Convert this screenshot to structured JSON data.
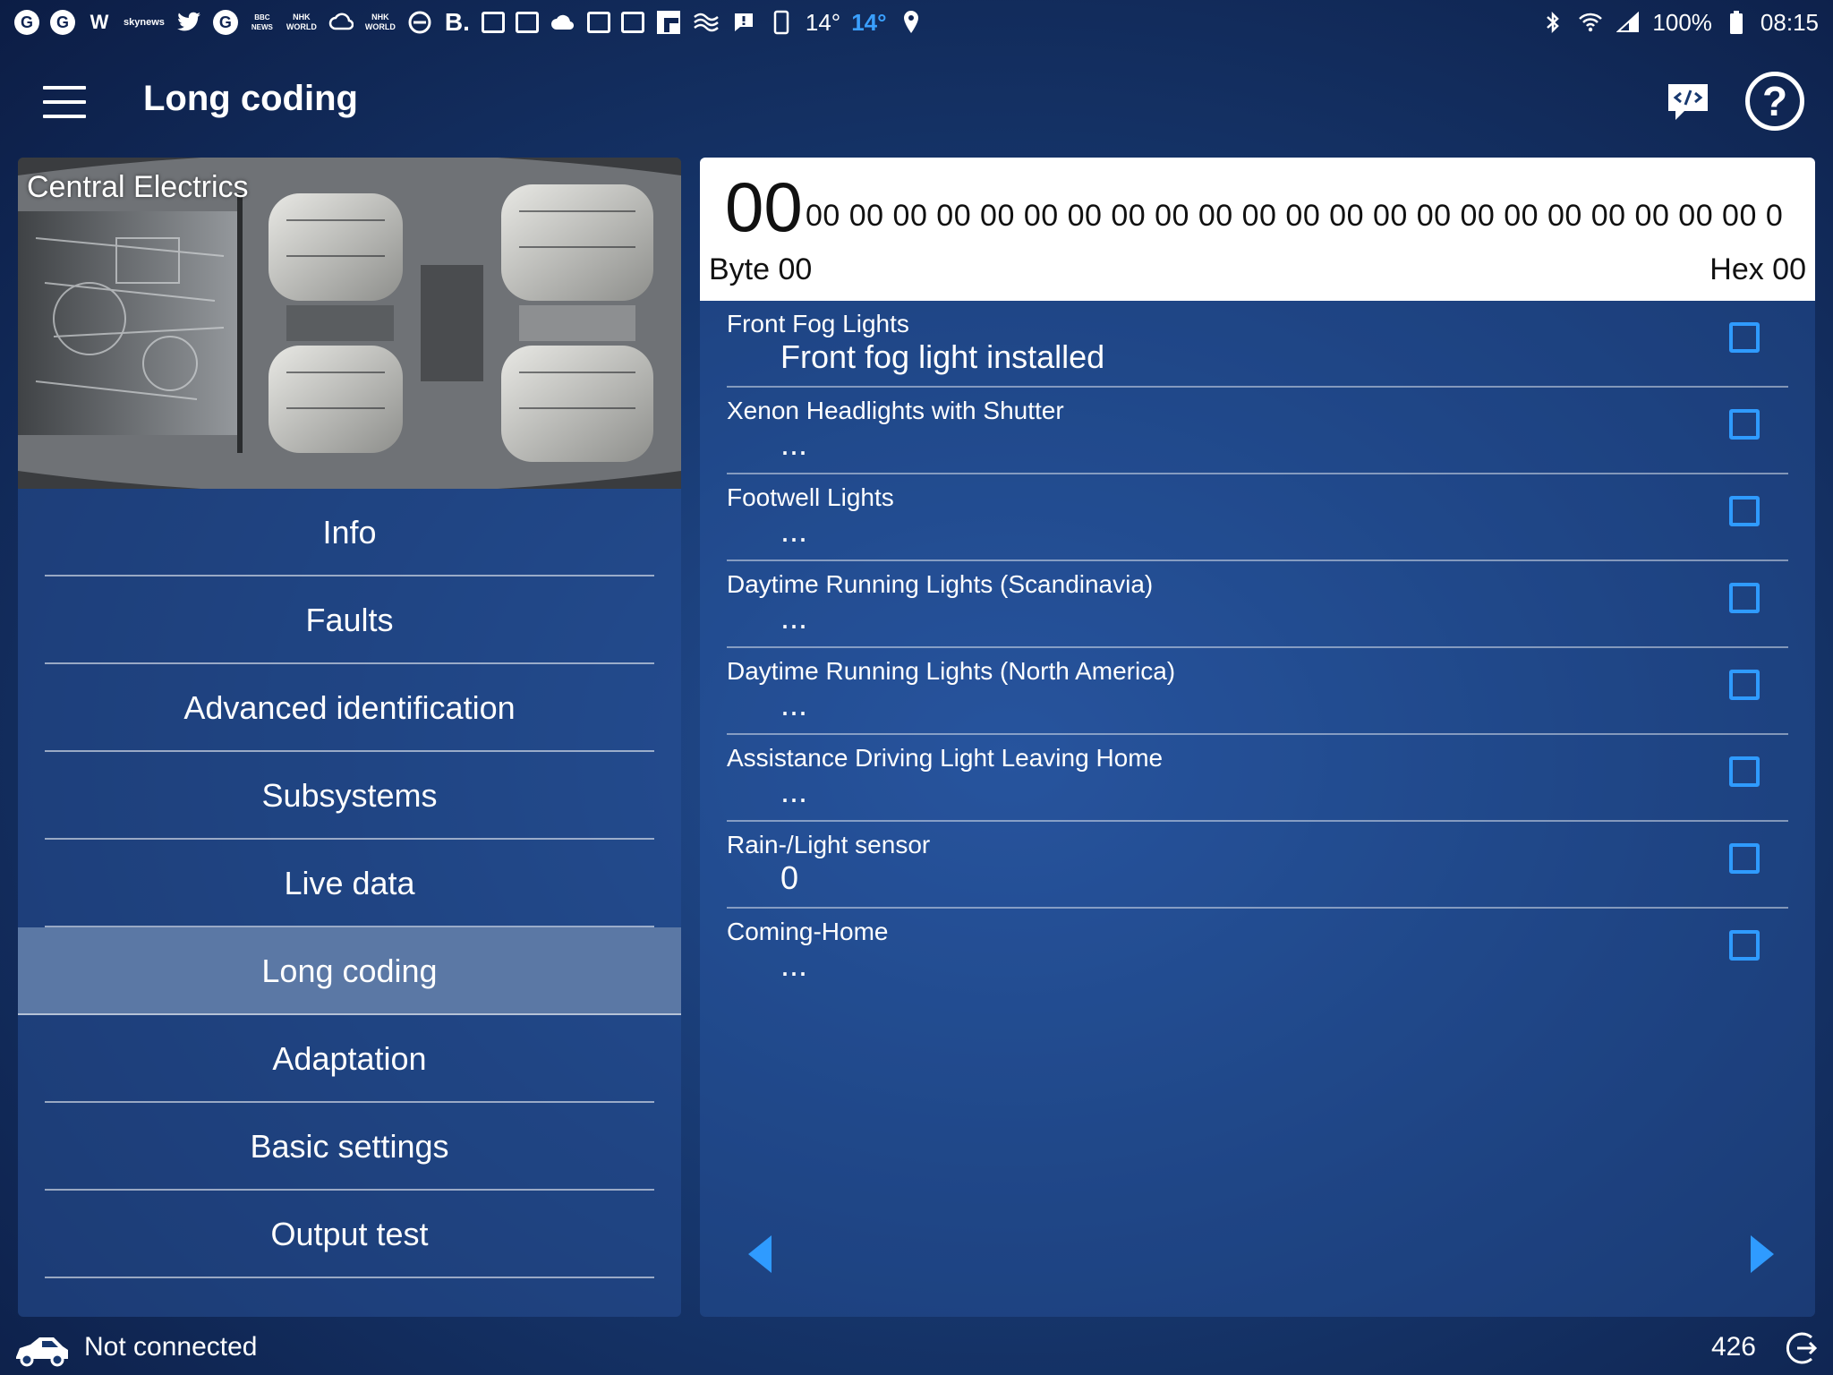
{
  "status_bar": {
    "left_icons": [
      "news-app-icon",
      "news-app-icon",
      "wikipedia-icon",
      "sky-news-icon",
      "twitter-icon",
      "news-app-icon",
      "bbc-news-icon",
      "nhk-world-icon",
      "cloud-sync-icon",
      "nhk-world-icon",
      "do-not-disturb-icon",
      "booking-icon",
      "calendar-icon",
      "gallery-icon",
      "cloud-icon",
      "calendar-icon",
      "calendar-icon",
      "flipboard-icon",
      "waves-icon",
      "alert-icon",
      "phone-icon",
      "location-icon"
    ],
    "sky_label": "sky",
    "news_label": "news",
    "bbc_label": "BBC NEWS",
    "nhk_label": "NHK WORLD",
    "wiki_label": "W",
    "booking_label": "B.",
    "temp_1": "14°",
    "temp_2": "14°",
    "battery": "100%",
    "time": "08:15",
    "accent_color": "#3aa0ff"
  },
  "app_bar": {
    "title": "Long coding",
    "menu_icon": "hamburger-menu-icon",
    "code_icon": "code-view-icon",
    "help_icon": "help-icon",
    "help_glyph": "?"
  },
  "left_panel": {
    "module_title": "Central Electrics",
    "nav_items": [
      {
        "label": "Info",
        "active": false
      },
      {
        "label": "Faults",
        "active": false
      },
      {
        "label": "Advanced identification",
        "active": false
      },
      {
        "label": "Subsystems",
        "active": false
      },
      {
        "label": "Live data",
        "active": false
      },
      {
        "label": "Long coding",
        "active": true
      },
      {
        "label": "Adaptation",
        "active": false
      },
      {
        "label": "Basic settings",
        "active": false
      },
      {
        "label": "Output test",
        "active": false
      }
    ]
  },
  "coding": {
    "current_byte_value": "00",
    "byte_row": "00 00 00 00 00 00 00 00 00 00 00 00 00 00 00 00 00 00 00 00 00 00 0",
    "byte_label": "Byte 00",
    "hex_label": "Hex 00",
    "checkbox_color": "#2f9bff",
    "rows": [
      {
        "label": "Front Fog Lights",
        "value": "Front fog light installed",
        "checked": false
      },
      {
        "label": "Xenon Headlights with Shutter",
        "value": "...",
        "checked": false
      },
      {
        "label": "Footwell Lights",
        "value": "...",
        "checked": false
      },
      {
        "label": "Daytime Running Lights (Scandinavia)",
        "value": "...",
        "checked": false
      },
      {
        "label": "Daytime Running Lights (North America)",
        "value": "...",
        "checked": false
      },
      {
        "label": "Assistance Driving Light Leaving Home",
        "value": "...",
        "checked": false
      },
      {
        "label": "Rain-/Light sensor",
        "value": "0",
        "checked": false
      },
      {
        "label": "Coming-Home",
        "value": "...",
        "checked": false
      }
    ]
  },
  "footer": {
    "connection_status": "Not connected",
    "counter": "426",
    "car_icon": "car-icon",
    "exit_icon": "exit-icon"
  }
}
